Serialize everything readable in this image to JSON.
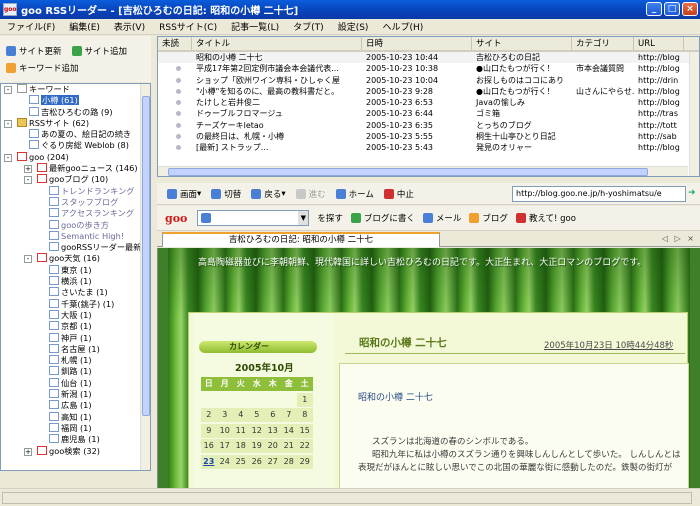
{
  "window": {
    "title": "goo RSSリーダー - [吉松ひろむの日記: 昭和の小樽 二十七]",
    "app_icon": "goo"
  },
  "menu": [
    "ファイル(F)",
    "編集(E)",
    "表示(V)",
    "RSSサイト(C)",
    "記事一覧(L)",
    "タブ(T)",
    "設定(S)",
    "ヘルプ(H)"
  ],
  "left_toolbar": {
    "refresh": "サイト更新",
    "add_site": "サイト追加",
    "add_keyword": "キーワード追加"
  },
  "tree": [
    "キーワード",
    "小樽 (61)",
    "吉松ひろむの路 (9)",
    "RSSサイト (62)",
    "あの夏の、絵日記の続き",
    "ぐるり房総 Weblob (8)",
    "goo (204)",
    "最新gooニュース (146)",
    "gooブログ (10)",
    "トレンドランキング",
    "スタッフブログ",
    "アクセスランキング",
    "gooの歩き方",
    "Semantic High!",
    "gooRSSリーダー最新",
    "goo天気 (16)",
    "東京 (1)",
    "横浜 (1)",
    "さいたま (1)",
    "千葉(銚子) (1)",
    "大阪 (1)",
    "京都 (1)",
    "神戸 (1)",
    "名古屋 (1)",
    "札幌 (1)",
    "釧路 (1)",
    "仙台 (1)",
    "新潟 (1)",
    "広島 (1)",
    "高知 (1)",
    "福岡 (1)",
    "鹿児島 (1)",
    "goo検索 (32)"
  ],
  "list": {
    "headers": [
      "未読",
      "タイトル",
      "日時",
      "サイト",
      "カテゴリ",
      "URL"
    ],
    "rows": [
      [
        "",
        "昭和の小樽 二十七",
        "2005-10-23 10:44",
        "吉松ひろむの日記",
        "",
        "http://blog"
      ],
      [
        "",
        "平成17年第2回定例市議会本会議代表...",
        "2005-10-23 10:38",
        "●山口たもつが行く！",
        "市本会議質問",
        "http://blog"
      ],
      [
        "",
        "ショップ「欧州ワイン専科・ひしゃく屋",
        "2005-10-23 10:04",
        "お探しものはココにあり",
        "",
        "http://drin"
      ],
      [
        "",
        "\"小樽\"を知るのに、最高の教科書だと。",
        "2005-10-23 9:28",
        "●山口たもつが行く！",
        "山さんにやらせ...",
        "http://blog"
      ],
      [
        "",
        "たけしと岩井俊二",
        "2005-10-23 6:53",
        "Javaの愉しみ",
        "",
        "http://blog"
      ],
      [
        "",
        "ドゥーブルフロマージュ",
        "2005-10-23 6:44",
        "ゴミ箱",
        "",
        "http://tras"
      ],
      [
        "",
        "チーズケーキletao",
        "2005-10-23 6:35",
        "とっちのブログ",
        "",
        "http://tott"
      ],
      [
        "",
        "の最終日は、札幌・小樽",
        "2005-10-23 5:55",
        "桐生十山亭ひとり日記",
        "",
        "http://sab"
      ],
      [
        "",
        "[最新] ストラップ...",
        "2005-10-23 5:43",
        "発見のオリャー",
        "",
        "http://blog"
      ]
    ]
  },
  "nav": {
    "view": "画面",
    "switch": "切替",
    "back": "戻る",
    "forward": "進む",
    "home": "ホーム",
    "stop": "中止",
    "url": "http://blog.goo.ne.jp/h-yoshimatsu/e"
  },
  "goo_toolbar": {
    "logo": "goo",
    "search_btn": "を探す",
    "blog_write": "ブログに書く",
    "mail": "メール",
    "blog": "ブログ",
    "teach": "教えて! goo"
  },
  "tab": {
    "label": "吉松ひろむの日記: 昭和の小樽 二十七",
    "controls": "◁ ▷ ×"
  },
  "page": {
    "banner": "高島陶磁器並びに李朝朝鮮、現代韓国に詳しい吉松ひろむの日記です。大正生まれ、大正ロマンのブログです。",
    "calendar_label": "カレンダー",
    "calendar_month": "2005年10月",
    "calendar_header": [
      "日",
      "月",
      "火",
      "水",
      "木",
      "金",
      "土"
    ],
    "calendar_weeks": [
      [
        "",
        "",
        "",
        "",
        "",
        "",
        "1"
      ],
      [
        "2",
        "3",
        "4",
        "5",
        "6",
        "7",
        "8"
      ],
      [
        "9",
        "10",
        "11",
        "12",
        "13",
        "14",
        "15"
      ],
      [
        "16",
        "17",
        "18",
        "19",
        "20",
        "21",
        "22"
      ],
      [
        "23",
        "24",
        "25",
        "26",
        "27",
        "28",
        "29"
      ]
    ],
    "post_heading": "昭和の小樽 二十七",
    "post_date": "2005年10月23日 10時44分48秒",
    "post_title": "昭和の小樽 二十七",
    "post_body": [
      "スズランは北海道の春のシンボルである。",
      "昭和九年に私は小樽のスズラン通りを興味しんしんとして歩いた。 しんしんとは",
      "表現だがほんとに眩しい思いでこの北国の華麗な街に感動したのだ。鉄製の街灯が"
    ]
  },
  "colors": {
    "title_blue": "#0a5ddb",
    "selection": "#316ac5",
    "goo_red": "#d01818",
    "bamboo_green": "#3f7f2a"
  }
}
